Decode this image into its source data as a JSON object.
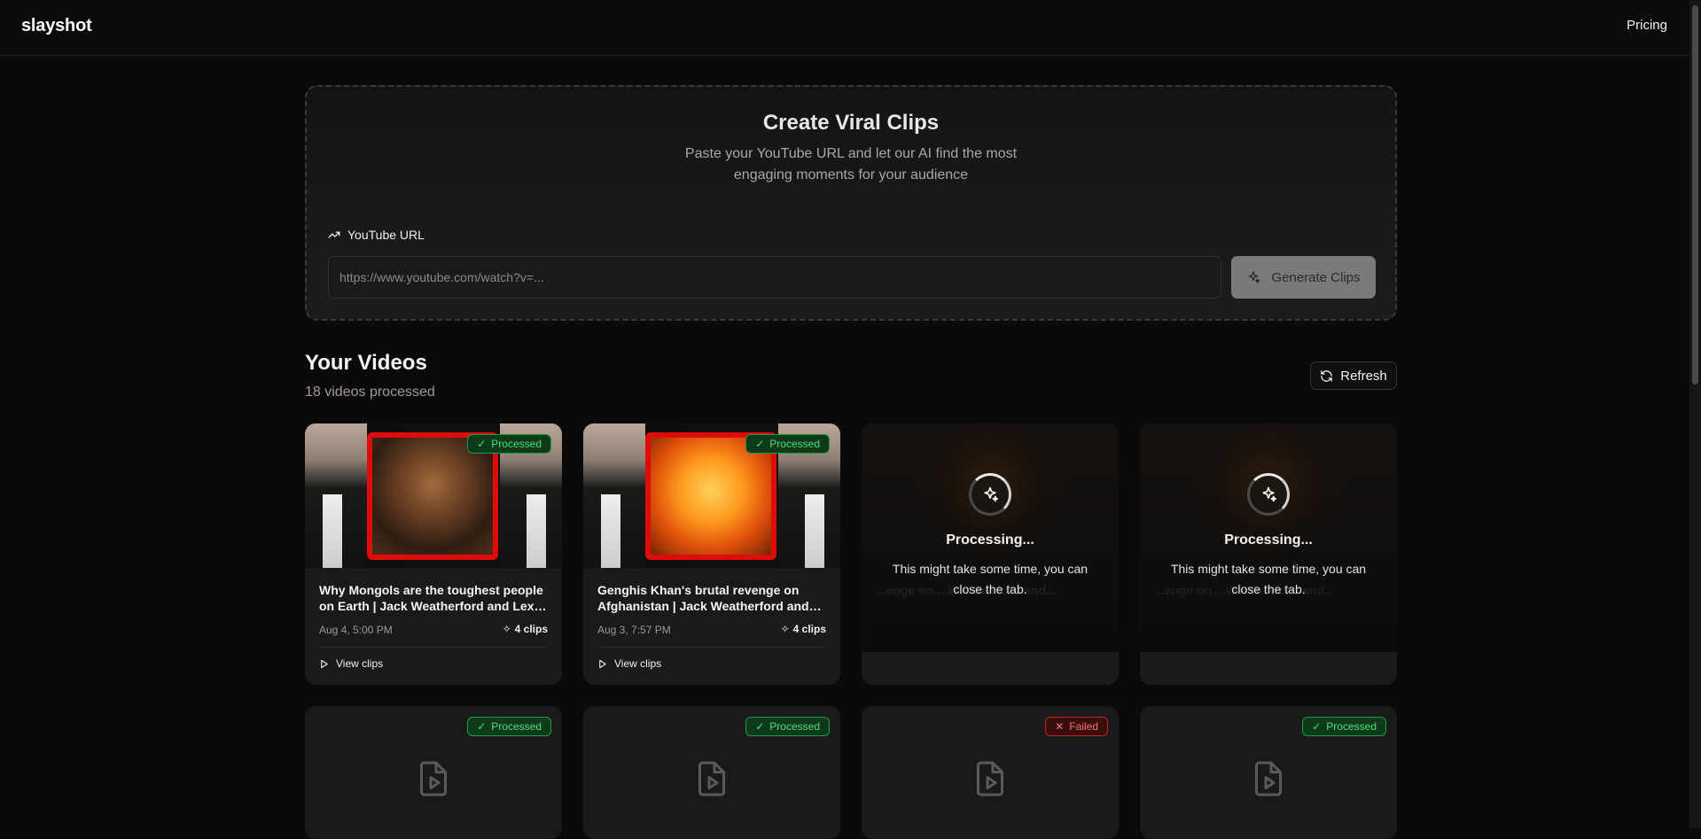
{
  "app": {
    "logo": "slayshot",
    "nav_pricing": "Pricing"
  },
  "hero": {
    "title": "Create Viral Clips",
    "subtitle": "Paste your YouTube URL and let our AI find the most engaging moments for your audience",
    "url_label": "YouTube URL",
    "url_placeholder": "https://www.youtube.com/watch?v=...",
    "url_value": "",
    "generate_label": "Generate Clips"
  },
  "videos": {
    "title": "Your Videos",
    "count_text": "18 videos processed",
    "refresh_label": "Refresh",
    "cards": [
      {
        "status": "Processed",
        "title": "Why Mongols are the toughest people on Earth | Jack Weatherford and Lex Fridman",
        "date": "Aug 4, 5:00 PM",
        "clips": "4 clips",
        "view_label": "View clips"
      },
      {
        "status": "Processed",
        "title": "Genghis Khan's brutal revenge on Afghanistan | Jack Weatherford and Lex Fridman",
        "date": "Aug 3, 7:57 PM",
        "clips": "4 clips",
        "view_label": "View clips"
      },
      {
        "status": "Processing...",
        "message": "This might take some time, you can close the tab.",
        "ghost_title": "...enge on ...Weatherford and..."
      },
      {
        "status": "Processing...",
        "message": "This might take some time, you can close the tab.",
        "ghost_title": "...enge on ...Weatherford and..."
      },
      {
        "status": "Processed"
      },
      {
        "status": "Processed"
      },
      {
        "status": "Failed"
      },
      {
        "status": "Processed"
      }
    ]
  },
  "colors": {
    "processed_badge": "#4ade80",
    "failed_badge": "#f87171",
    "frame_red": "#e00b0b",
    "background": "#0a0a0a"
  }
}
